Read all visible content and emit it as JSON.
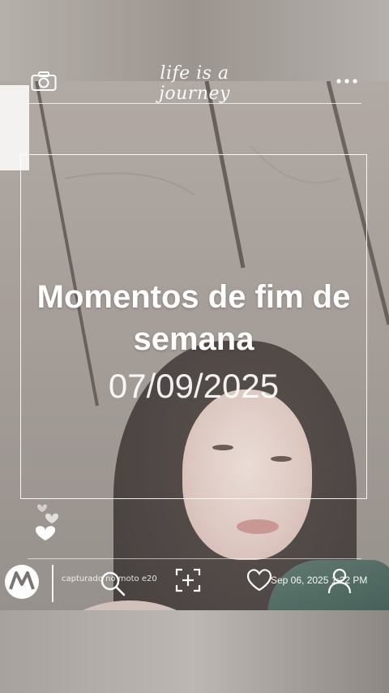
{
  "header": {
    "tagline": "life is a journey",
    "left_icon": "camera-icon",
    "right_icon": "more-dots-icon"
  },
  "overlay": {
    "title": "Momentos de fim de semana",
    "date": "07/09/2025"
  },
  "decor": {
    "hearts_icon": "hearts-icon"
  },
  "toolbar": {
    "icons": [
      "search-icon",
      "add-frame-icon",
      "heart-icon",
      "person-icon"
    ]
  },
  "watermark": {
    "brand_icon": "motorola-logo",
    "caption": "capturado no moto e20",
    "timestamp": "Sep 06, 2025 1:22 PM"
  },
  "colors": {
    "overlay_text": "#ffffff",
    "photo_tone": "#9e958f",
    "shirt": "#2e4a42"
  }
}
